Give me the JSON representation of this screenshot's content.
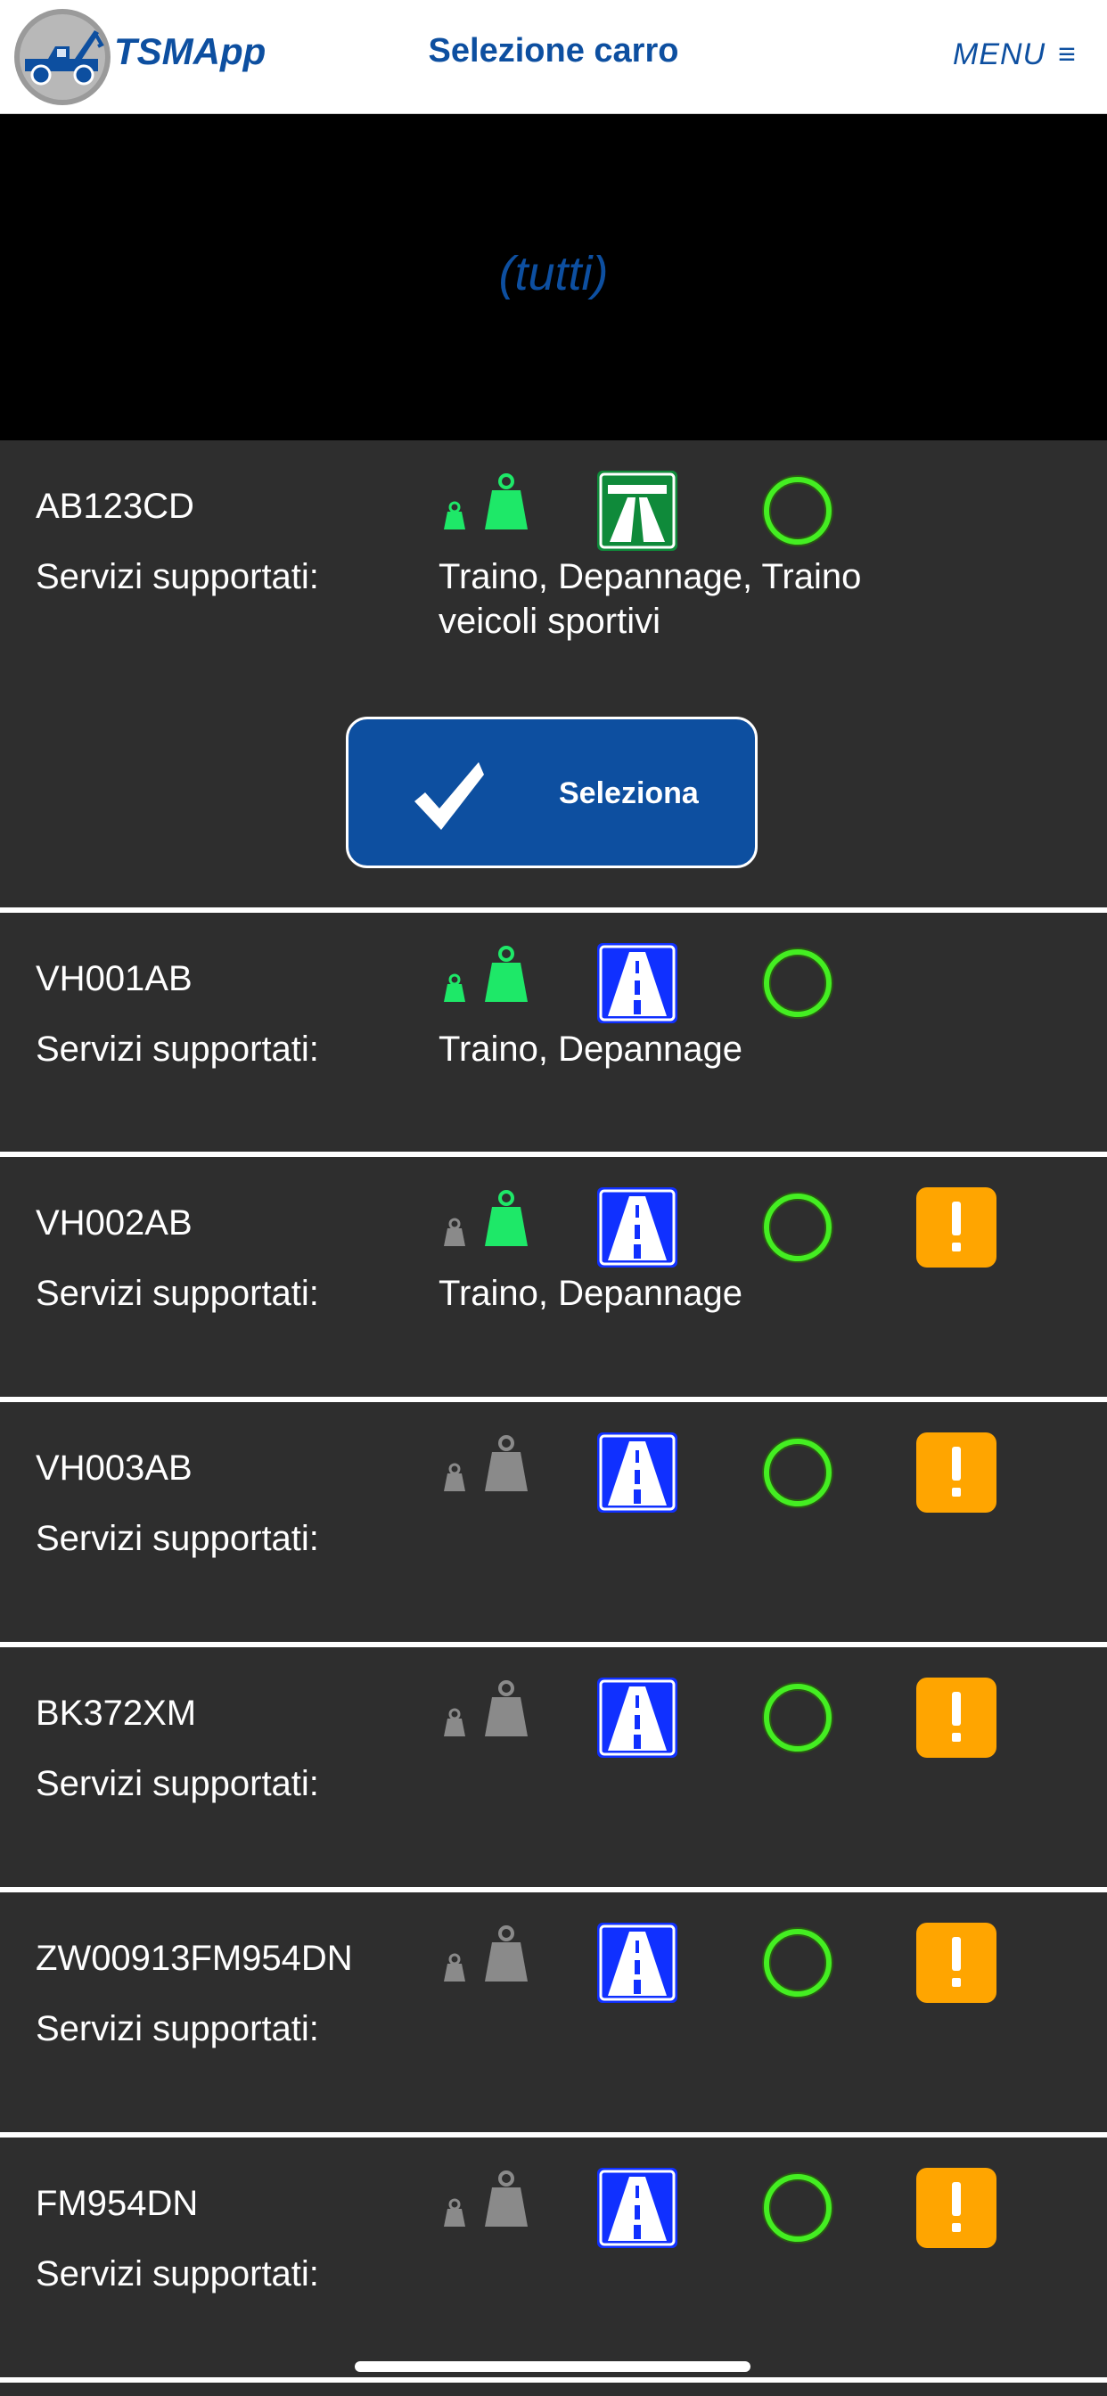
{
  "header": {
    "brand": "TSMApp",
    "title": "Selezione carro",
    "menu_label": "MENU",
    "menu_icon": "≡"
  },
  "filter": {
    "label": "(tutti)"
  },
  "colors": {
    "brand_blue": "#0d4fa0",
    "active_green": "#1ee868",
    "inactive_gray": "#8a8a8a",
    "highway_green": "#0f8a3a",
    "road_blue": "#1030ff",
    "warning_orange": "#ffa500",
    "ring_green": "#44ee22"
  },
  "trucks": [
    {
      "plate": "AB123CD",
      "services_label": "Servizi supportati:",
      "services": "Traino, Depannage, Traino veicoli sportivi",
      "weight_icons": [
        "active",
        "active"
      ],
      "road_icon": "highway-icon",
      "status_icon": "status-ring-icon",
      "warning": false,
      "expanded": true,
      "select_label": "Seleziona"
    },
    {
      "plate": "VH001AB",
      "services_label": "Servizi supportati:",
      "services": "Traino, Depannage",
      "weight_icons": [
        "active",
        "active"
      ],
      "road_icon": "road-icon",
      "status_icon": "status-ring-icon",
      "warning": false
    },
    {
      "plate": "VH002AB",
      "services_label": "Servizi supportati:",
      "services": "Traino, Depannage",
      "weight_icons": [
        "inactive",
        "active"
      ],
      "road_icon": "road-icon",
      "status_icon": "status-ring-icon",
      "warning": true
    },
    {
      "plate": "VH003AB",
      "services_label": "Servizi supportati:",
      "services": "",
      "weight_icons": [
        "inactive",
        "inactive"
      ],
      "road_icon": "road-icon",
      "status_icon": "status-ring-icon",
      "warning": true
    },
    {
      "plate": "BK372XM",
      "services_label": "Servizi supportati:",
      "services": "",
      "weight_icons": [
        "inactive",
        "inactive"
      ],
      "road_icon": "road-icon",
      "status_icon": "status-ring-icon",
      "warning": true
    },
    {
      "plate": "ZW00913FM954DN",
      "services_label": "Servizi supportati:",
      "services": "",
      "weight_icons": [
        "inactive",
        "inactive"
      ],
      "road_icon": "road-icon",
      "status_icon": "status-ring-icon",
      "warning": true
    },
    {
      "plate": "FM954DN",
      "services_label": "Servizi supportati:",
      "services": "",
      "weight_icons": [
        "inactive",
        "inactive"
      ],
      "road_icon": "road-icon",
      "status_icon": "status-ring-icon",
      "warning": true
    }
  ]
}
